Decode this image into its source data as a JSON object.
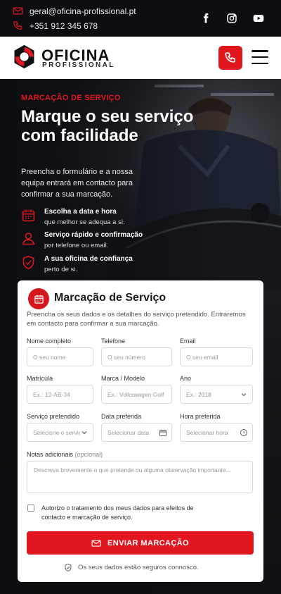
{
  "topbar": {
    "email": "geral@oficina-profissional.pt",
    "phone": "+351 912 345 678",
    "social": [
      "facebook-icon",
      "instagram-icon",
      "youtube-icon"
    ]
  },
  "brand": {
    "name": "OFICINA",
    "tagline": "PROFISSIONAL",
    "accent": "#e1161f"
  },
  "hero": {
    "eyebrow": "MARCAÇÃO DE SERVIÇO",
    "title": "Marque o seu serviço com facilidade",
    "description": "Preencha o formulário e a nossa equipa entrará em contacto para confirmar a sua marcação.",
    "features": [
      {
        "icon": "calendar-icon",
        "title": "Escolha a data e hora",
        "subtitle": "que melhor se adequa a si."
      },
      {
        "icon": "user-icon",
        "title": "Serviço rápido e confirmação",
        "subtitle": "por telefone ou email."
      },
      {
        "icon": "shield-check-icon",
        "title": "A sua oficina de confiança",
        "subtitle": "perto de si."
      }
    ]
  },
  "form": {
    "title": "Marcação de Serviço",
    "subtitle": "Preencha os seus dados e os detalhes do serviço pretendido. Entraremos em contacto para confirmar a sua marcação.",
    "fields": {
      "name": {
        "label": "Nome completo",
        "placeholder": "O seu nome"
      },
      "phone": {
        "label": "Telefone",
        "placeholder": "O seu número"
      },
      "email": {
        "label": "Email",
        "placeholder": "O seu email"
      },
      "plate": {
        "label": "Matrícula",
        "placeholder": "Ex.: 12-AB-34"
      },
      "model": {
        "label": "Marca / Modelo",
        "placeholder": "Ex.: Volkswagen Golf"
      },
      "year": {
        "label": "Ano",
        "placeholder": "Ex.: 2018"
      },
      "service": {
        "label": "Serviço pretendido",
        "placeholder": "Selecione o serviço"
      },
      "date": {
        "label": "Data preferida",
        "placeholder": "Selecionar data"
      },
      "time": {
        "label": "Hora preferida",
        "placeholder": "Selecionar hora"
      },
      "notes": {
        "label": "Notas adicionais",
        "optional": "(opcional)",
        "placeholder": "Descreva brevemente o que pretende ou alguma observação importante..."
      }
    },
    "consent": "Autorizo o tratamento dos meus dados para efeitos de contacto e marcação de serviço.",
    "consent_checked": false,
    "submit_label": "ENVIAR MARCAÇÃO",
    "secure_note": "Os seus dados estão seguros connosco."
  }
}
